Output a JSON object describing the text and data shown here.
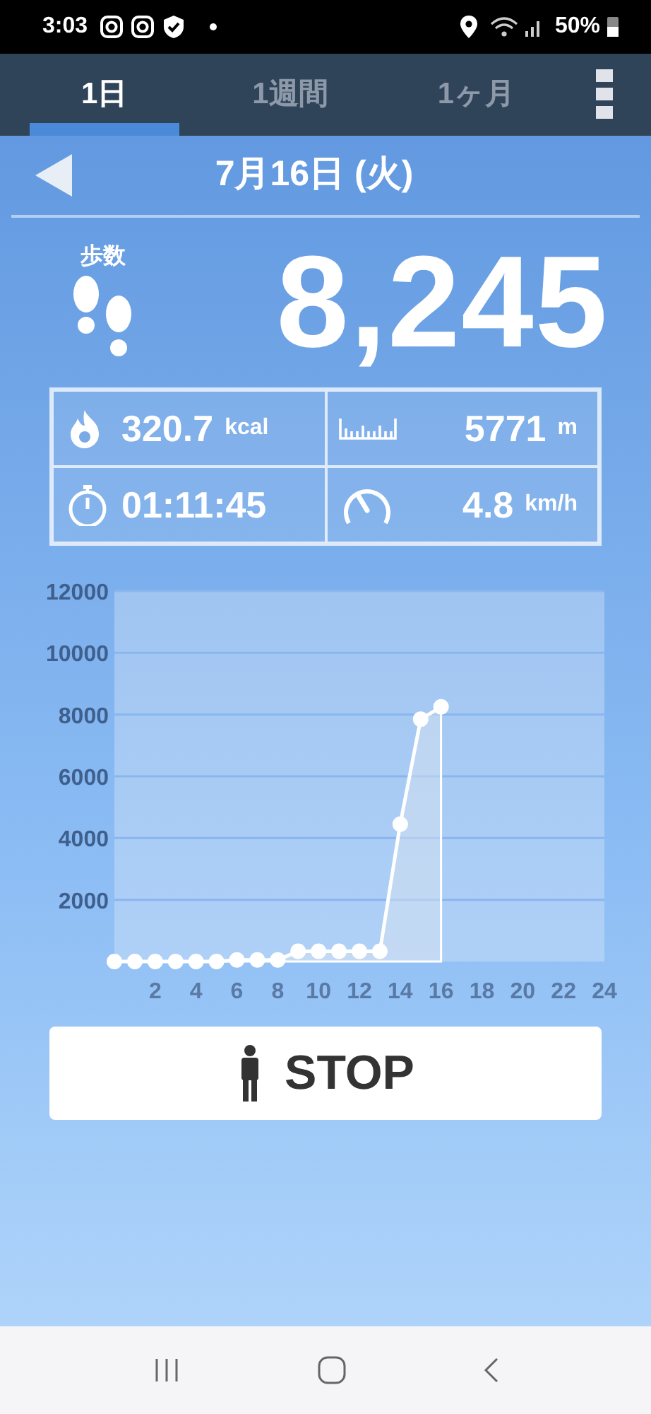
{
  "status_bar": {
    "time": "3:03",
    "battery": "50%"
  },
  "tabs": [
    {
      "label": "1日",
      "selected": true
    },
    {
      "label": "1週間",
      "selected": false
    },
    {
      "label": "1ヶ月",
      "selected": false
    }
  ],
  "date": "7月16日 (火)",
  "steps": {
    "label": "歩数",
    "value": "8,245"
  },
  "stats": [
    {
      "kind": "calories",
      "value": "320.7",
      "unit": "kcal"
    },
    {
      "kind": "distance",
      "value": "5771",
      "unit": "m"
    },
    {
      "kind": "time",
      "value": "01:11:45"
    },
    {
      "kind": "speed",
      "value": "4.8",
      "unit": "km/h"
    }
  ],
  "chart_data": {
    "type": "area",
    "x": [
      0,
      1,
      2,
      3,
      4,
      5,
      6,
      7,
      8,
      9,
      10,
      11,
      12,
      13,
      14,
      15,
      16
    ],
    "series": [
      {
        "color": "#ffffff",
        "values": [
          0,
          0,
          0,
          0,
          0,
          0,
          50,
          50,
          50,
          330,
          330,
          330,
          330,
          330,
          4450,
          7850,
          8250
        ]
      }
    ],
    "grid": true,
    "xlim": [
      0,
      24
    ],
    "ylim": [
      0,
      12000
    ],
    "xticks": [
      2,
      4,
      6,
      8,
      10,
      12,
      14,
      16,
      18,
      20,
      22,
      24
    ],
    "yticks": [
      2000,
      4000,
      6000,
      8000,
      10000,
      12000
    ]
  },
  "stop_button": {
    "label": "STOP"
  }
}
